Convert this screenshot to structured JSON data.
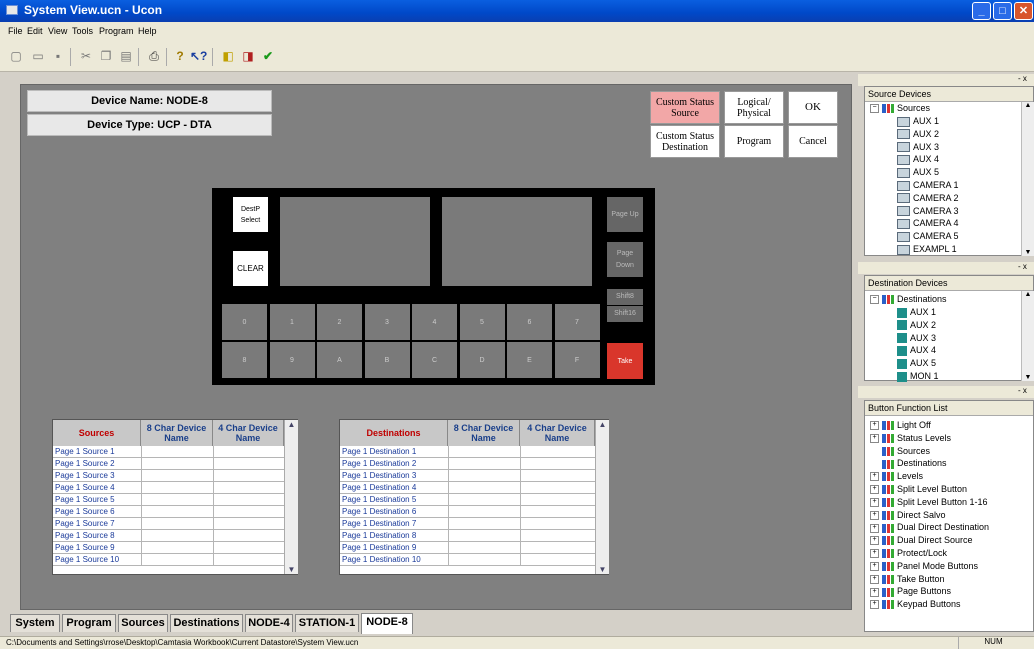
{
  "window": {
    "title": "System View.ucn - Ucon"
  },
  "menu": [
    "File",
    "Edit",
    "View",
    "Tools",
    "Program",
    "Help"
  ],
  "device": {
    "name_label": "Device Name: NODE-8",
    "type_label": "Device Type: UCP - DTA"
  },
  "top_buttons": {
    "custom_status_source": "Custom Status Source",
    "logical_physical": "Logical/ Physical",
    "ok": "OK",
    "custom_status_destination": "Custom Status Destination",
    "program": "Program",
    "cancel": "Cancel"
  },
  "panel": {
    "destp_select": "DestP Select",
    "clear": "CLEAR",
    "page_up": "Page Up",
    "page_down": "Page Down",
    "shift8": "Shift8",
    "shift16": "Shift16",
    "take": "Take",
    "keys_row1": [
      "0",
      "1",
      "2",
      "3",
      "4",
      "5",
      "6",
      "7"
    ],
    "keys_row2": [
      "8",
      "9",
      "A",
      "B",
      "C",
      "D",
      "E",
      "F"
    ]
  },
  "sources_table": {
    "headers": [
      "Sources",
      "8 Char Device Name",
      "4 Char Device Name"
    ],
    "rows": [
      "Page 1 Source  1",
      "Page 1 Source  2",
      "Page 1 Source  3",
      "Page 1 Source  4",
      "Page 1 Source  5",
      "Page 1 Source  6",
      "Page 1 Source  7",
      "Page 1 Source  8",
      "Page 1 Source  9",
      "Page 1 Source  10"
    ]
  },
  "destinations_table": {
    "headers": [
      "Destinations",
      "8 Char Device Name",
      "4 Char Device Name"
    ],
    "rows": [
      "Page 1 Destination  1",
      "Page 1 Destination  2",
      "Page 1 Destination  3",
      "Page 1 Destination  4",
      "Page 1 Destination  5",
      "Page 1 Destination  6",
      "Page 1 Destination  7",
      "Page 1 Destination  8",
      "Page 1 Destination  9",
      "Page 1 Destination  10"
    ]
  },
  "tabs": [
    "System",
    "Program",
    "Sources",
    "Destinations",
    "NODE-4",
    "STATION-1",
    "NODE-8"
  ],
  "status": {
    "path": "C:\\Documents and Settings\\rrose\\Desktop\\Camtasia Workbook\\Current Datastore\\System View.ucn",
    "num": "NUM"
  },
  "source_devices": {
    "title": "Source Devices",
    "root": "Sources",
    "items": [
      "AUX  1",
      "AUX  2",
      "AUX  3",
      "AUX  4",
      "AUX  5",
      "CAMERA 1",
      "CAMERA 2",
      "CAMERA 3",
      "CAMERA 4",
      "CAMERA 5",
      "EXAMPL 1"
    ]
  },
  "destination_devices": {
    "title": "Destination Devices",
    "root": "Destinations",
    "items": [
      "AUX  1",
      "AUX  2",
      "AUX  3",
      "AUX  4",
      "AUX  5",
      "MON  1"
    ]
  },
  "button_functions": {
    "title": "Button Function List",
    "items": [
      "Light Off",
      "Status Levels",
      "Sources",
      "Destinations",
      "Levels",
      "Split Level Button",
      "Split Level Button 1-16",
      "Direct Salvo",
      "Dual Direct Destination",
      "Dual Direct Source",
      "Protect/Lock",
      "Panel Mode Buttons",
      "Take Button",
      "Page Buttons",
      "Keypad Buttons"
    ],
    "expandable": [
      true,
      true,
      false,
      false,
      true,
      true,
      true,
      true,
      true,
      true,
      true,
      true,
      true,
      true,
      true
    ]
  },
  "colors": {
    "titlebar": "#0048c8",
    "take": "#d9362b",
    "pink_button": "#f2a7a7",
    "background": "#808080"
  }
}
